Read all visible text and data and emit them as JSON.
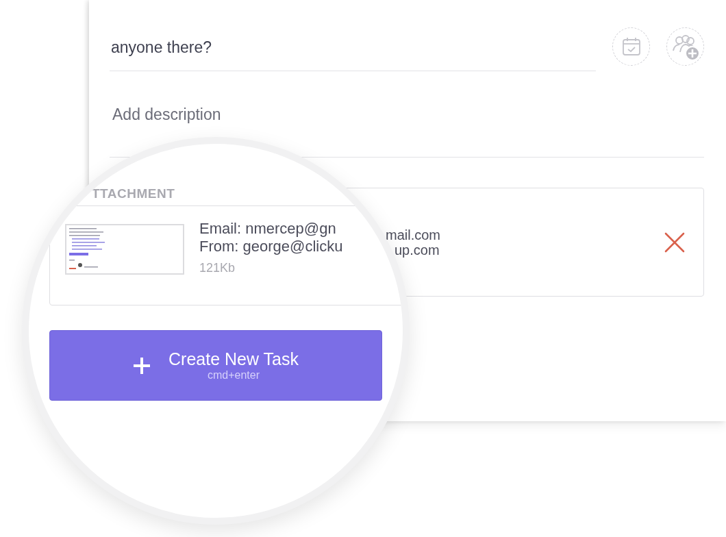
{
  "task": {
    "title": "anyone there?",
    "description_placeholder": "Add description"
  },
  "attachment_behind": {
    "lines": [
      "mail.com",
      "up.com"
    ]
  },
  "magnifier": {
    "section_label": "TTACHMENT",
    "attachment": {
      "lines": [
        "Email: nmercep@gn",
        "From: george@clicku"
      ],
      "size": "121Kb"
    },
    "button": {
      "label": "Create New Task",
      "shortcut": "cmd+enter"
    }
  }
}
